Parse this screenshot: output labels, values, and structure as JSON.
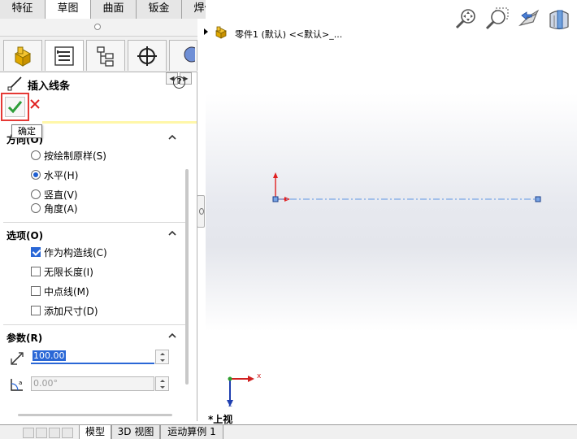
{
  "command_tabs": [
    "特征",
    "草图",
    "曲面",
    "钣金",
    "焊件"
  ],
  "active_tab_index": 1,
  "property_manager": {
    "title": "插入线条",
    "ok_tooltip": "确定",
    "orientation": {
      "heading_visible": "方向(O)",
      "options": [
        "按绘制原样(S)",
        "水平(H)",
        "竖直(V)",
        "角度(A)"
      ],
      "selected_index": 1
    },
    "options_section": {
      "heading": "选项(O)",
      "items": [
        {
          "label": "作为构造线(C)",
          "checked": true
        },
        {
          "label": "无限长度(I)",
          "checked": false
        },
        {
          "label": "中点线(M)",
          "checked": false
        },
        {
          "label": "添加尺寸(D)",
          "checked": false
        }
      ]
    },
    "parameters": {
      "heading": "参数(R)",
      "length_value": "100.00",
      "angle_value": "0.00°"
    }
  },
  "graphics": {
    "part_name": "零件1 (默认) <<默认>_...",
    "view_label": "*上视",
    "axis_x": "x",
    "axis_z": "z",
    "construction_line_color": "#7aa6e6"
  },
  "bottom_tabs": [
    "模型",
    "3D 视图",
    "运动算例 1"
  ],
  "active_bottom_tab_index": 0,
  "colors": {
    "accent_blue": "#2a67d6",
    "ok_green": "#2f9e3a",
    "cancel_red": "#e02020",
    "highlight_red": "#e53935"
  }
}
